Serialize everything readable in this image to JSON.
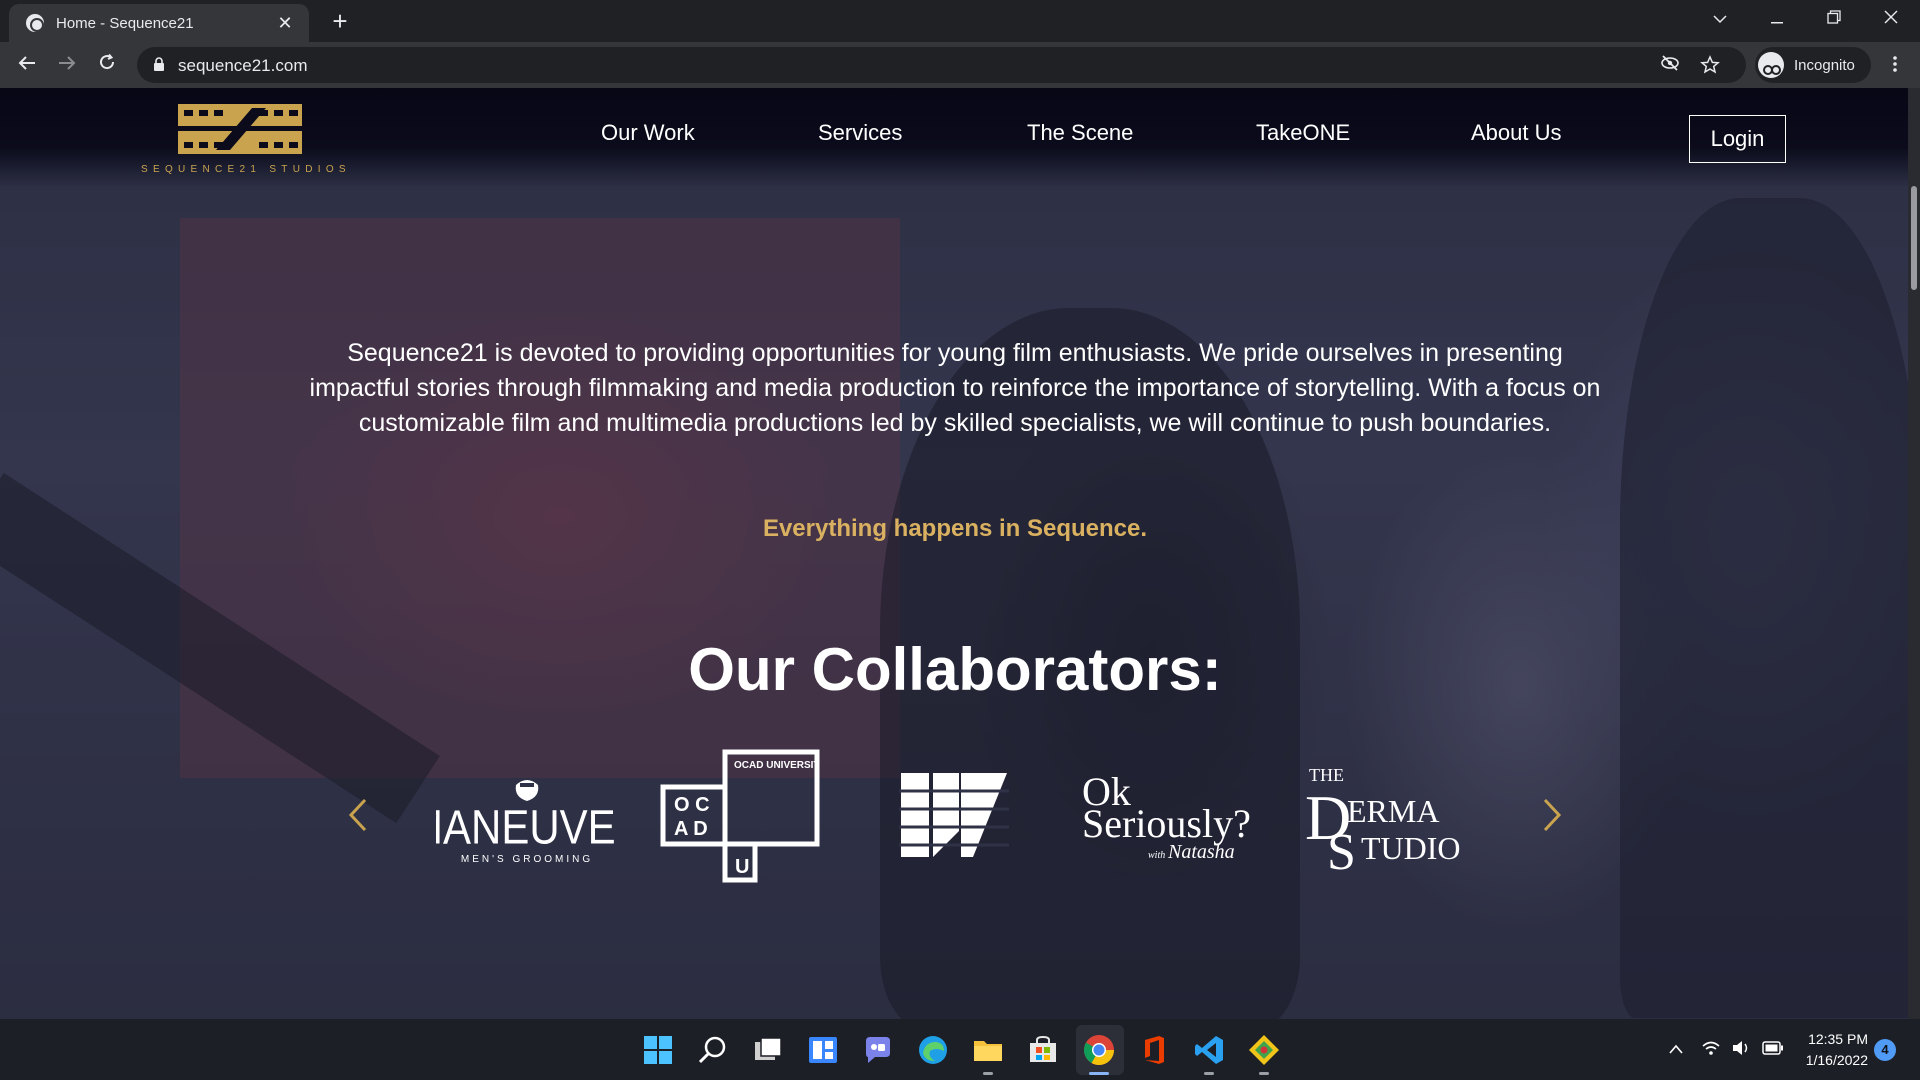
{
  "browser": {
    "tab_title": "Home - Sequence21",
    "tab_close": "✕",
    "new_tab": "+",
    "url": "sequence21.com",
    "profile_label": "Incognito",
    "window_controls": [
      "chevron-down-icon",
      "minimize-icon",
      "restore-icon",
      "close-icon"
    ]
  },
  "site": {
    "logo_text": "SEQUENCE21 STUDIOS",
    "nav": [
      "Our Work",
      "Services",
      "The Scene",
      "TakeONE",
      "About Us"
    ],
    "login_label": "Login",
    "intro": "Sequence21 is devoted to providing opportunities for young film enthusiasts. We pride ourselves in presenting impactful stories through filmmaking and media production to reinforce the importance of storytelling. With a focus on customizable film and multimedia productions led by skilled specialists, we will continue to push boundaries.",
    "tagline": "Everything happens in Sequence.",
    "collaborators_title": "Our Collaborators:",
    "collaborators": {
      "maneuver": {
        "name": "MANEUVER",
        "sub": "MEN'S GROOMING"
      },
      "ocad": {
        "top": "OCAD UNIVERSITY",
        "oc": "O C",
        "ad": "A D",
        "u": "U"
      },
      "ok": {
        "line1": "Ok",
        "line2": "Seriously?",
        "with": "with",
        "name": "Natasha"
      },
      "derma": {
        "the": "THE",
        "d": "D",
        "erma": "ERMA",
        "s": "S",
        "tudio": "TUDIO"
      }
    },
    "accent_color": "#d9b160"
  },
  "taskbar": {
    "time": "12:35 PM",
    "date": "1/16/2022",
    "notifications": "4"
  }
}
